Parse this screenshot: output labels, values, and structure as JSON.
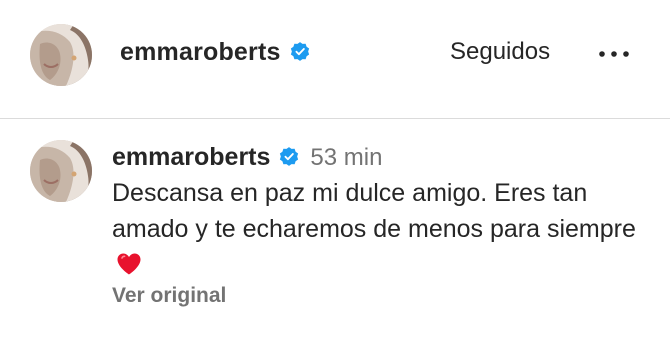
{
  "header": {
    "avatar_icon": "profile-photo",
    "username": "emmaroberts",
    "verified_icon": "verified-badge-icon",
    "follow_label": "Seguidos",
    "more_icon": "more-options-icon"
  },
  "comment": {
    "avatar_icon": "profile-photo",
    "username": "emmaroberts",
    "verified_icon": "verified-badge-icon",
    "time": "53 min",
    "text": "Descansa en paz mi dulce amigo. Eres tan amado y te echaremos de menos para siempre",
    "emoji_icon": "red-heart-icon",
    "see_original_label": "Ver original"
  },
  "colors": {
    "verified": "#1d9bf0",
    "text": "#262626",
    "secondary_text": "#737373",
    "divider": "#dbdbdb",
    "heart": "#e8122d"
  }
}
